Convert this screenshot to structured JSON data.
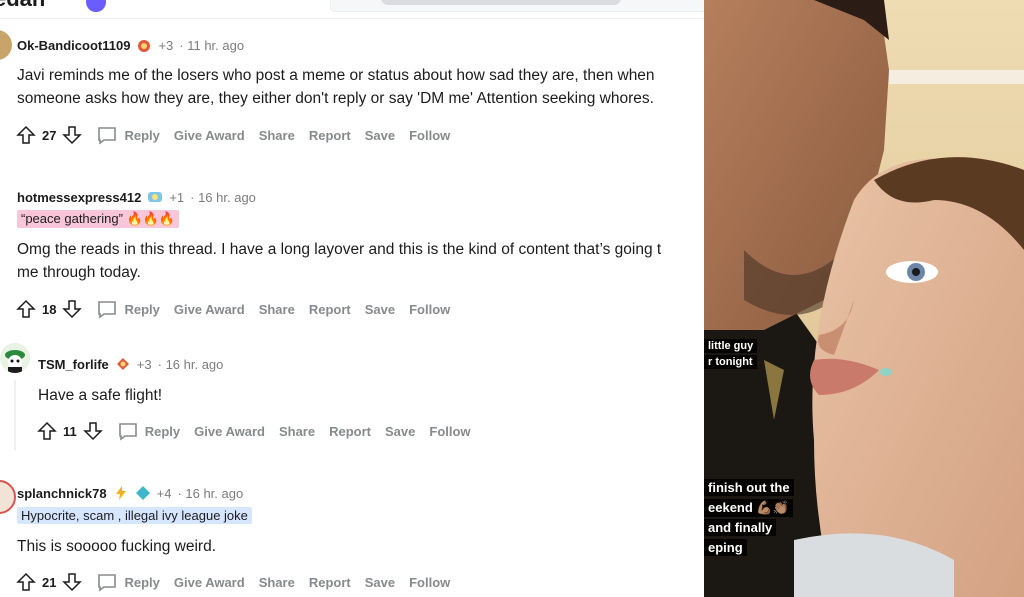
{
  "header": {
    "title_fragment": "edan"
  },
  "comments": [
    {
      "username": "Ok-Bandicoot1109",
      "karma": "+3",
      "time": "· 11 hr. ago",
      "flair": "",
      "body_lines": [
        "Javi reminds me of the losers who post a meme or status about how sad they are, then when",
        "someone asks how they are, they either don't reply or say 'DM me' Attention seeking whores."
      ],
      "score": "27"
    },
    {
      "username": "hotmessexpress412",
      "karma": "+1",
      "time": "· 16 hr. ago",
      "flair": "“peace gathering” 🔥🔥🔥",
      "body_lines": [
        "Omg the reads in this thread. I have a long layover and this is the kind of content that’s going t",
        "me through today."
      ],
      "score": "18"
    },
    {
      "username": "TSM_forlife",
      "karma": "+3",
      "time": "· 16 hr. ago",
      "flair": "",
      "body_lines": [
        "Have a safe flight!"
      ],
      "score": "11"
    },
    {
      "username": "splanchnick78",
      "karma": "+4",
      "time": "· 16 hr. ago",
      "flair": "Hypocrite, scam , illegal ivy league joke",
      "body_lines": [
        "This is sooooo fucking weird."
      ],
      "score": "21"
    }
  ],
  "actions": {
    "reply": "Reply",
    "give_award": "Give Award",
    "share": "Share",
    "report": "Report",
    "save": "Save",
    "follow": "Follow"
  },
  "photo_overlay": {
    "line1": "little guy",
    "line2": "r tonight",
    "line3": "finish out the",
    "line4": "eekend 💪🏽👏🏽",
    "line5": "and finally",
    "line6": "eping"
  },
  "colors": {
    "flair_pink": "#f9c5d8",
    "flair_blue": "#d6e6ff",
    "muted": "#878a8c"
  }
}
